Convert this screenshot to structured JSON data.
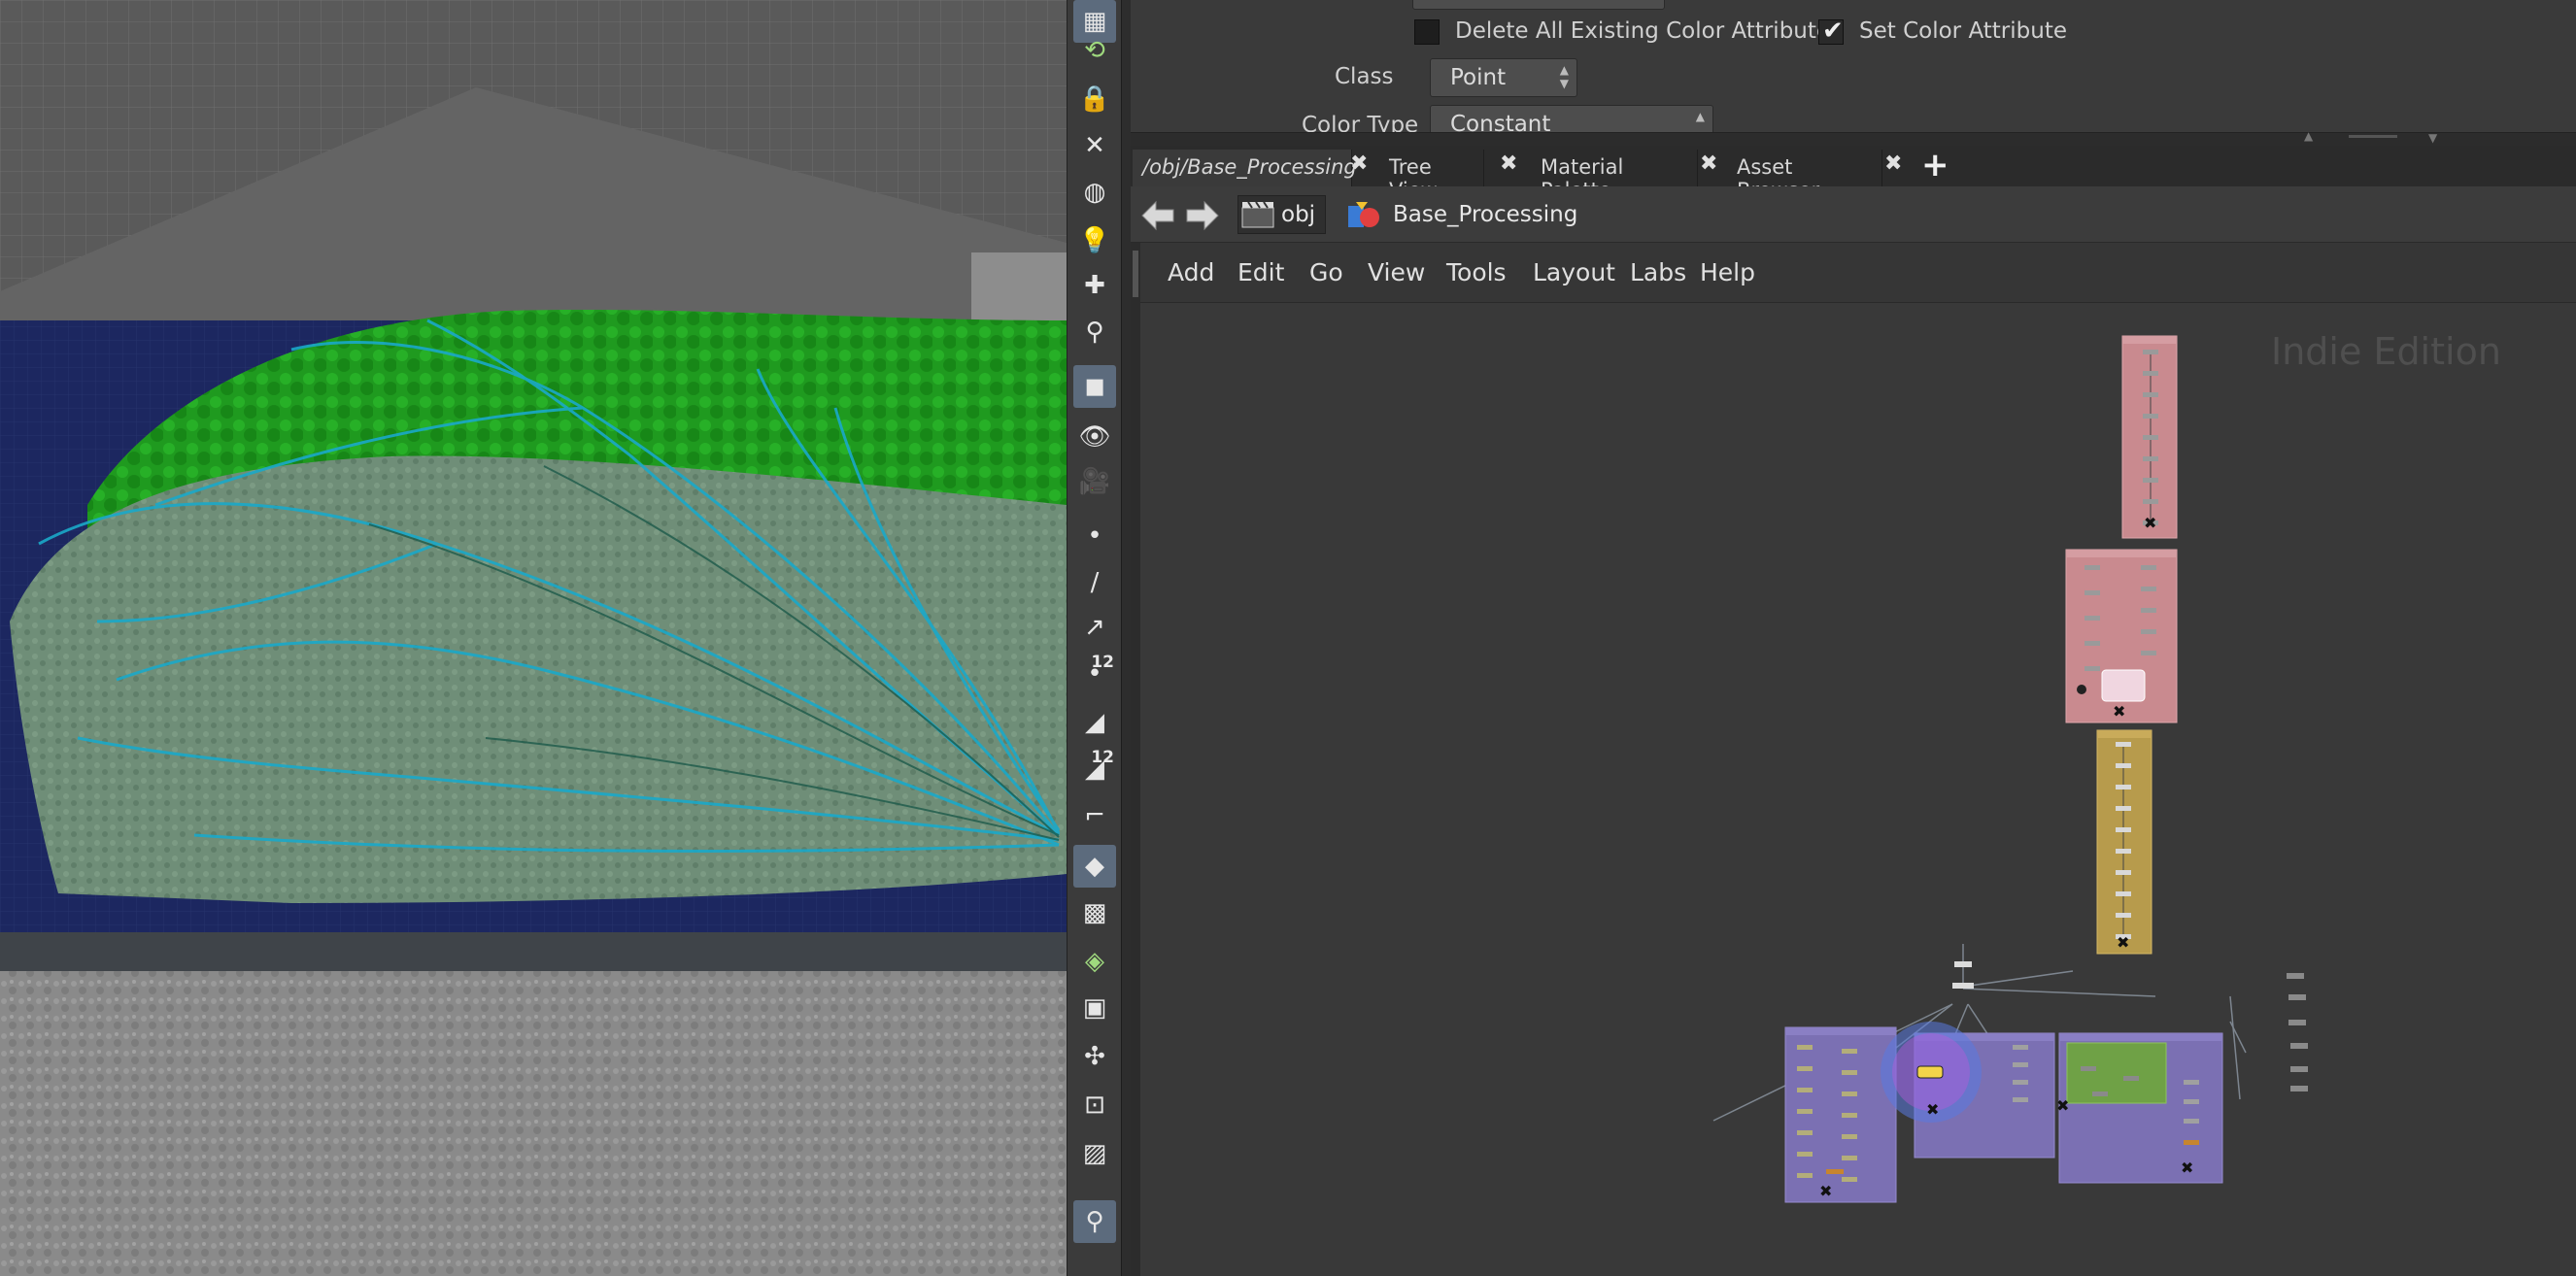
{
  "params": {
    "delete_attrs_label": "Delete All Existing Color Attributes",
    "delete_attrs_checked": false,
    "set_color_label": "Set Color Attribute",
    "set_color_checked": true,
    "class_label": "Class",
    "class_value": "Point",
    "color_type_label": "Color Type",
    "color_type_value": "Constant"
  },
  "tabs": [
    {
      "label": "/obj/Base_Processing",
      "active": true
    },
    {
      "label": "Tree View",
      "active": false
    },
    {
      "label": "Material Palette",
      "active": false
    },
    {
      "label": "Asset Browser",
      "active": false
    }
  ],
  "path": {
    "context": "obj",
    "node": "Base_Processing"
  },
  "menu": [
    "Add",
    "Edit",
    "Go",
    "View",
    "Tools",
    "Layout",
    "Labs",
    "Help"
  ],
  "network": {
    "watermark": "Indie Edition"
  },
  "shelf": {
    "tools": [
      "display-options-icon",
      "snapping-icon",
      "lock-camera-icon",
      "hide-icon",
      "ghost-icon",
      "light-icon",
      "add-light-icon",
      "light-link-icon",
      "shaded-mode-icon",
      "camera-icon",
      "camera-view-icon",
      "point-display-icon",
      "point-normal-icon",
      "vector-icon",
      "point-number-icon",
      "prim-normal-icon",
      "prim-number-icon",
      "curve-icon",
      "shaded-prim-icon",
      "texture-icon",
      "uv-icon",
      "uv-view-icon",
      "handle-icon",
      "safe-area-icon",
      "background-image-icon",
      "location-icon"
    ],
    "badge_numbers": [
      "12",
      "12"
    ]
  },
  "colors": {
    "pink_box": "#c98a8f",
    "yellow_box": "#b79b4c",
    "purple_box": "#7b70b3",
    "green_box": "#6fa146",
    "viewport_blue": "#1e2a5a"
  }
}
